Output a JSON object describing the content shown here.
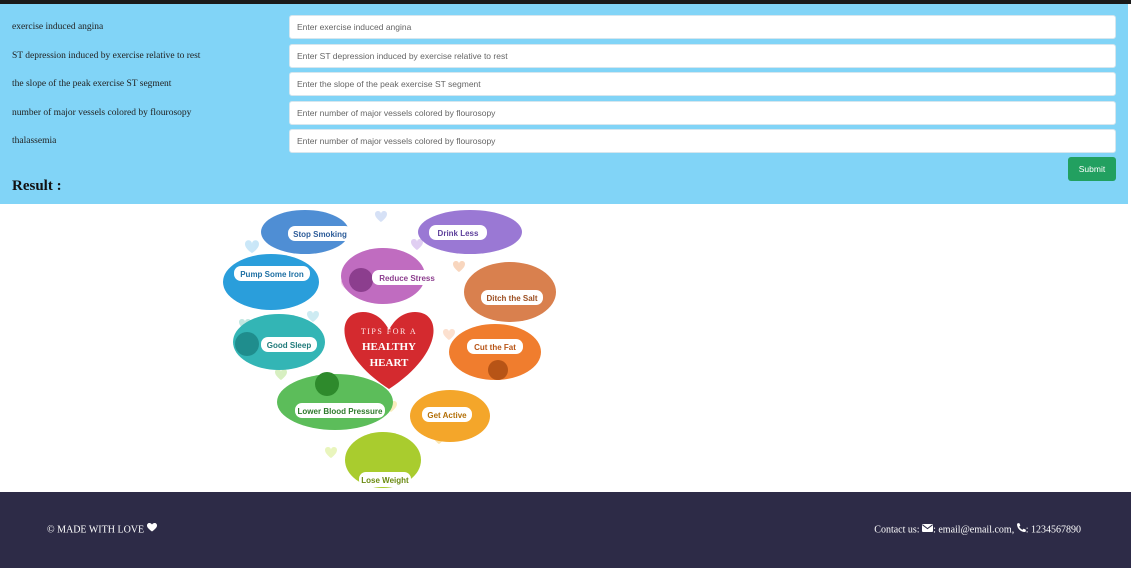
{
  "form": {
    "fields": [
      {
        "label": "exercise induced angina",
        "placeholder": "Enter exercise induced angina"
      },
      {
        "label": "ST depression induced by exercise relative to rest",
        "placeholder": "Enter ST depression induced by exercise relative to rest"
      },
      {
        "label": "the slope of the peak exercise ST segment",
        "placeholder": "Enter the slope of the peak exercise ST segment"
      },
      {
        "label": "number of major vessels colored by flourosopy",
        "placeholder": "Enter number of major vessels colored by flourosopy"
      },
      {
        "label": "thalassemia",
        "placeholder": "Enter number of major vessels colored by flourosopy"
      }
    ],
    "submit_label": "Submit"
  },
  "result": {
    "heading": "Result :"
  },
  "artwork": {
    "center_line1": "TIPS FOR A",
    "center_line2": "HEALTHY",
    "center_line3": "HEART",
    "tips": {
      "stop_smoking": "Stop Smoking",
      "drink_less": "Drink Less",
      "pump_iron": "Pump Some Iron",
      "reduce_stress": "Reduce Stress",
      "ditch_salt": "Ditch the Salt",
      "good_sleep": "Good Sleep",
      "cut_fat": "Cut the Fat",
      "lower_bp": "Lower Blood Pressure",
      "get_active": "Get Active",
      "lose_weight": "Lose Weight"
    }
  },
  "footer": {
    "made_with": "© MADE WITH LOVE",
    "contact_prefix": "Contact us:",
    "email": ": email@email.com,",
    "phone": ": 1234567890"
  },
  "colors": {
    "form_bg": "#81d4f7",
    "submit_bg": "#22a060",
    "footer_bg": "#2d2b47",
    "heart_red": "#d42a2f"
  },
  "icons": [
    "heart-icon",
    "envelope-icon",
    "phone-icon"
  ]
}
